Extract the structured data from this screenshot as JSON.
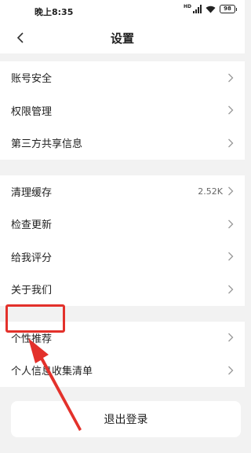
{
  "status_bar": {
    "time": "晚上8:35",
    "network": "HD",
    "battery": "98"
  },
  "nav": {
    "title": "设置"
  },
  "group1": [
    {
      "label": "账号安全"
    },
    {
      "label": "权限管理"
    },
    {
      "label": "第三方共享信息"
    }
  ],
  "group2": [
    {
      "label": "清理缓存",
      "value": "2.52K"
    },
    {
      "label": "检查更新"
    },
    {
      "label": "给我评分"
    },
    {
      "label": "关于我们"
    }
  ],
  "group3": [
    {
      "label": "个性推荐"
    },
    {
      "label": "个人信息收集清单"
    }
  ],
  "logout_label": "退出登录",
  "colors": {
    "annotation": "#e3312b",
    "background": "#f2f2f2"
  },
  "icons": {
    "back": "chevron-left-icon",
    "row_arrow": "chevron-right-icon"
  }
}
